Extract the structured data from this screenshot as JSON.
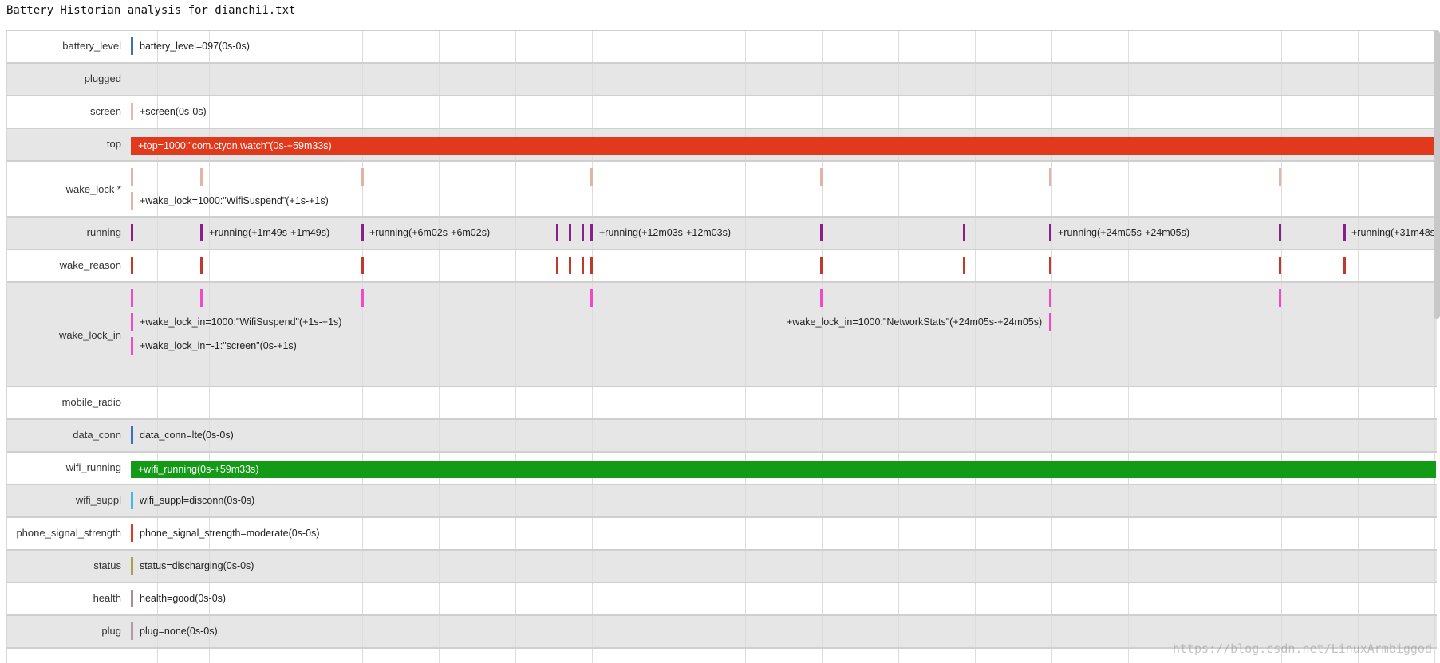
{
  "page": {
    "title": "Battery Historian analysis for dianchi1.txt",
    "watermark": "https://blog.csdn.net/LinuxArmbiggod"
  },
  "colors": {
    "battery_level": "#3a6fc4",
    "screen": "#e6b8a8",
    "top": "#e0391b",
    "wake_lock": "#e2b4a3",
    "running": "#8a1e8a",
    "wake_reason": "#c0392b",
    "wake_lock_in": "#ee4bc4",
    "data_conn": "#3a6fc4",
    "wifi_running": "#139a17",
    "wifi_suppl": "#46b8e0",
    "phone_signal_strength": "#e0391b",
    "status": "#a8a04a",
    "health": "#b08a98",
    "plug": "#b09aa8"
  },
  "rows": [
    {
      "key": "battery_level",
      "label": "battery_level",
      "texts": [
        "battery_level=097(0s-0s)"
      ]
    },
    {
      "key": "plugged",
      "label": "plugged",
      "texts": []
    },
    {
      "key": "screen",
      "label": "screen",
      "texts": [
        "+screen(0s-0s)"
      ]
    },
    {
      "key": "top",
      "label": "top",
      "bar_text": "+top=1000:\"com.ctyon.watch\"(0s-+59m33s)"
    },
    {
      "key": "wake_lock",
      "label": "wake_lock *",
      "texts": [
        "+wake_lock=1000:\"WifiSuspend\"(+1s-+1s)"
      ]
    },
    {
      "key": "running",
      "label": "running",
      "texts": [
        "+running(+1m49s-+1m49s)",
        "+running(+6m02s-+6m02s)",
        "+running(+12m03s-+12m03s)",
        "+running(+24m05s-+24m05s)",
        "+running(+31m48s"
      ]
    },
    {
      "key": "wake_reason",
      "label": "wake_reason",
      "texts": []
    },
    {
      "key": "wake_lock_in",
      "label": "wake_lock_in",
      "texts": [
        "+wake_lock_in=1000:\"WifiSuspend\"(+1s-+1s)",
        "+wake_lock_in=-1:\"screen\"(0s-+1s)",
        "+wake_lock_in=1000:\"NetworkStats\"(+24m05s-+24m05s)"
      ]
    },
    {
      "key": "mobile_radio",
      "label": "mobile_radio",
      "texts": []
    },
    {
      "key": "data_conn",
      "label": "data_conn",
      "texts": [
        "data_conn=lte(0s-0s)"
      ]
    },
    {
      "key": "wifi_running",
      "label": "wifi_running",
      "bar_text": "+wifi_running(0s-+59m33s)"
    },
    {
      "key": "wifi_suppl",
      "label": "wifi_suppl",
      "texts": [
        "wifi_suppl=disconn(0s-0s)"
      ]
    },
    {
      "key": "phone_signal_strength",
      "label": "phone_signal_strength",
      "texts": [
        "phone_signal_strength=moderate(0s-0s)"
      ]
    },
    {
      "key": "status",
      "label": "status",
      "texts": [
        "status=discharging(0s-0s)"
      ]
    },
    {
      "key": "health",
      "label": "health",
      "texts": [
        "health=good(0s-0s)"
      ]
    },
    {
      "key": "plug",
      "label": "plug",
      "texts": [
        "plug=none(0s-0s)"
      ]
    },
    {
      "key": "truncated",
      "label": "",
      "texts": []
    }
  ]
}
